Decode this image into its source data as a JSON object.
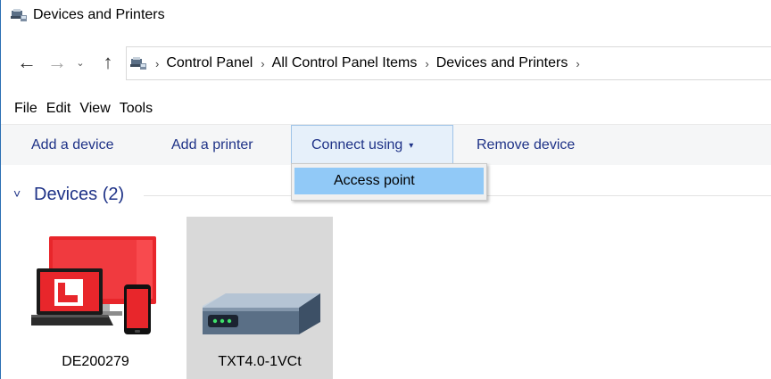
{
  "window": {
    "title": "Devices and Printers"
  },
  "nav": {
    "back_glyph": "←",
    "forward_glyph": "→",
    "recent_glyph": "⌄",
    "up_glyph": "↑",
    "separator": "›",
    "breadcrumbs": [
      "Control Panel",
      "All Control Panel Items",
      "Devices and Printers"
    ]
  },
  "menu": {
    "items": [
      "File",
      "Edit",
      "View",
      "Tools"
    ]
  },
  "commands": {
    "add_device": "Add a device",
    "add_printer": "Add a printer",
    "connect_using": "Connect using",
    "connect_caret": "▾",
    "remove_device": "Remove device"
  },
  "dropdown": {
    "items": [
      "Access point"
    ]
  },
  "group": {
    "chevron": "˅",
    "title": "Devices (2)"
  },
  "devices": [
    {
      "name": "DE200279",
      "icon": "computer-devices-icon"
    },
    {
      "name": "TXT4.0-1VCt",
      "icon": "router-icon"
    }
  ],
  "colors": {
    "accent_text": "#1e3287",
    "selected_menu_item": "#91c9f7",
    "selected_tile": "#d9d9d9"
  }
}
